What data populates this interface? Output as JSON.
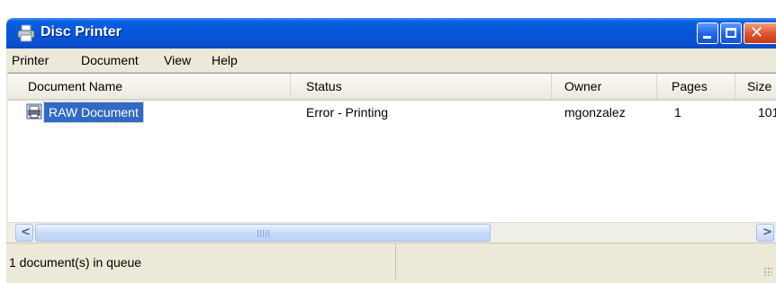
{
  "window": {
    "title": "Disc Printer"
  },
  "menu": [
    "Printer",
    "Document",
    "View",
    "Help"
  ],
  "columns": [
    "Document Name",
    "Status",
    "Owner",
    "Pages",
    "Size"
  ],
  "rows": [
    {
      "name": "RAW Document",
      "status": "Error - Printing",
      "owner": "mgonzalez",
      "pages": "1",
      "size": "101"
    }
  ],
  "status_bar": {
    "text": "1 document(s) in queue"
  },
  "icons": {
    "app": "printer-icon",
    "document": "print-document-icon",
    "minimize": "minimize-icon",
    "maximize": "maximize-icon",
    "close": "close-icon",
    "scroll_left": "chevron-left-icon",
    "scroll_right": "chevron-right-icon"
  },
  "colors": {
    "titlebar": "#0756d8",
    "selection": "#316ac5",
    "close": "#e0562d"
  }
}
